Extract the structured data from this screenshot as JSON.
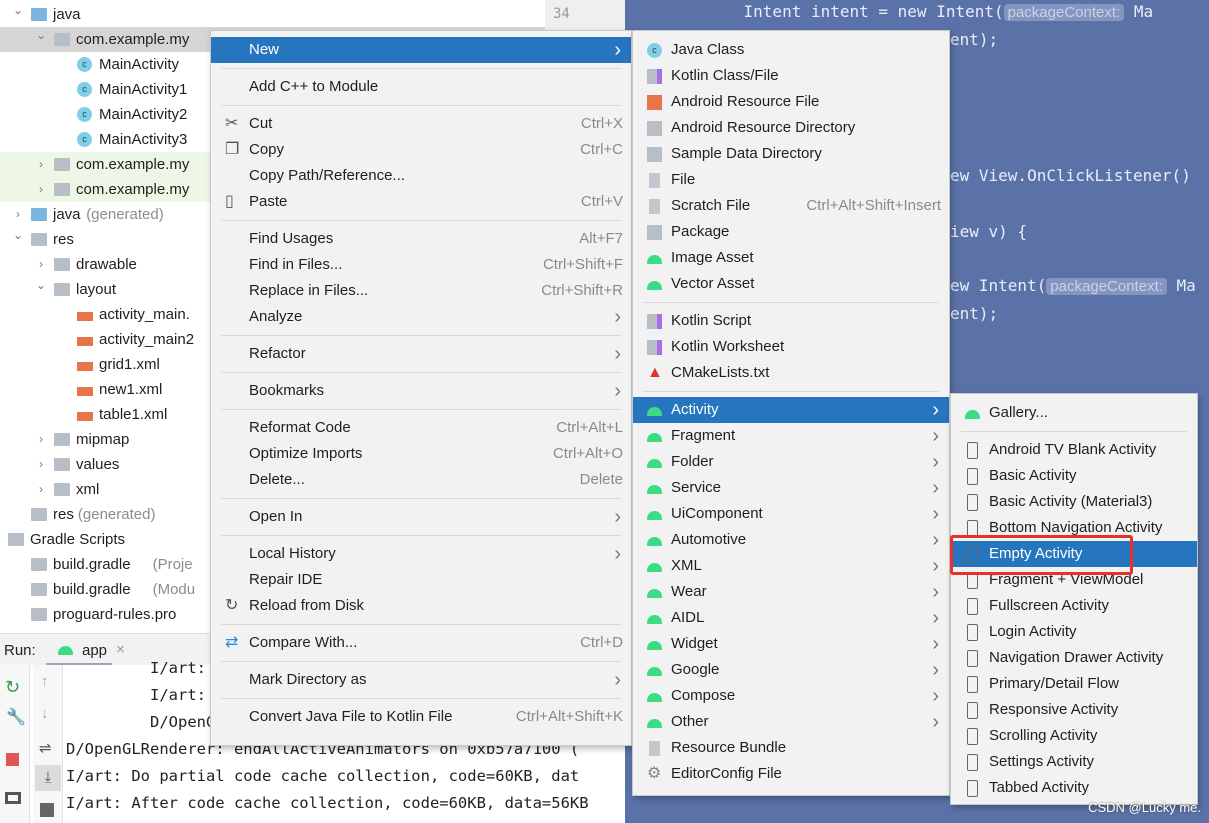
{
  "tree": [
    {
      "label": "java",
      "indent": 0,
      "chev": "v",
      "icon": "folder-blue"
    },
    {
      "label": "com.example.my",
      "indent": 1,
      "chev": "v",
      "icon": "folder",
      "state": "sel"
    },
    {
      "label": "MainActivity",
      "indent": 2,
      "icon": "class"
    },
    {
      "label": "MainActivity1",
      "indent": 2,
      "icon": "class"
    },
    {
      "label": "MainActivity2",
      "indent": 2,
      "icon": "class"
    },
    {
      "label": "MainActivity3",
      "indent": 2,
      "icon": "class"
    },
    {
      "label": "com.example.my",
      "indent": 1,
      "chev": ">",
      "icon": "folder",
      "state": "green"
    },
    {
      "label": "com.example.my",
      "indent": 1,
      "chev": ">",
      "icon": "folder",
      "state": "green"
    },
    {
      "label": "java",
      "suffix": " (generated)",
      "indent": 0,
      "chev": ">",
      "icon": "folder-blue"
    },
    {
      "label": "res",
      "indent": 0,
      "chev": "v",
      "icon": "folder"
    },
    {
      "label": "drawable",
      "indent": 1,
      "chev": ">",
      "icon": "folder"
    },
    {
      "label": "layout",
      "indent": 1,
      "chev": "v",
      "icon": "folder"
    },
    {
      "label": "activity_main.",
      "indent": 2,
      "icon": "xml"
    },
    {
      "label": "activity_main2",
      "indent": 2,
      "icon": "xml"
    },
    {
      "label": "grid1.xml",
      "indent": 2,
      "icon": "xml"
    },
    {
      "label": "new1.xml",
      "indent": 2,
      "icon": "xml"
    },
    {
      "label": "table1.xml",
      "indent": 2,
      "icon": "xml"
    },
    {
      "label": "mipmap",
      "indent": 1,
      "chev": ">",
      "icon": "folder"
    },
    {
      "label": "values",
      "indent": 1,
      "chev": ">",
      "icon": "folder"
    },
    {
      "label": "xml",
      "indent": 1,
      "chev": ">",
      "icon": "folder"
    },
    {
      "label": "res",
      "suffix": " (generated)",
      "indent": 0,
      "icon": "folder"
    },
    {
      "label": "Gradle Scripts",
      "indent": -1,
      "chev": "v",
      "icon": "gradle"
    },
    {
      "label": "build.gradle",
      "suffix": " (Proje",
      "indent": 0,
      "icon": "gradle"
    },
    {
      "label": "build.gradle",
      "suffix": " (Modu",
      "indent": 0,
      "icon": "gradle"
    },
    {
      "label": "proguard-rules.pro",
      "indent": 0,
      "icon": "doc"
    }
  ],
  "gutter": {
    "line": "34"
  },
  "code": [
    {
      "text": "    Intent intent = new Intent(",
      "hint": "packageContext:",
      "after": " Ma"
    },
    {
      "text": "ent);"
    },
    {
      "text": "ew View.OnClickListener()"
    },
    {
      "text": "iew v) {"
    },
    {
      "text": "ew Intent(",
      "hint": "packageContext:",
      "after": " Ma"
    },
    {
      "text": "ent);"
    }
  ],
  "run": {
    "label": "Run:",
    "tab": "app",
    "close": "×"
  },
  "console": [
    "I/art: After",
    "I/art: Increa",
    "D/OpenGLRende",
    "D/OpenGLRenderer: endAllActiveAnimators on 0xb57a7100 (",
    "I/art: Do partial code cache collection, code=60KB, dat",
    "I/art: After code cache collection, code=60KB, data=56KB"
  ],
  "menu1": [
    {
      "label": "New",
      "arrow": true,
      "hl": true
    },
    {
      "sep": true
    },
    {
      "label": "Add C++ to Module"
    },
    {
      "sep": true
    },
    {
      "label": "Cut",
      "shortcut": "Ctrl+X",
      "icon": "scissors"
    },
    {
      "label": "Copy",
      "shortcut": "Ctrl+C",
      "icon": "copy"
    },
    {
      "label": "Copy Path/Reference..."
    },
    {
      "label": "Paste",
      "shortcut": "Ctrl+V",
      "icon": "clipboard"
    },
    {
      "sep": true
    },
    {
      "label": "Find Usages",
      "shortcut": "Alt+F7"
    },
    {
      "label": "Find in Files...",
      "shortcut": "Ctrl+Shift+F"
    },
    {
      "label": "Replace in Files...",
      "shortcut": "Ctrl+Shift+R"
    },
    {
      "label": "Analyze",
      "arrow": true
    },
    {
      "sep": true
    },
    {
      "label": "Refactor",
      "arrow": true
    },
    {
      "sep": true
    },
    {
      "label": "Bookmarks",
      "arrow": true
    },
    {
      "sep": true
    },
    {
      "label": "Reformat Code",
      "shortcut": "Ctrl+Alt+L"
    },
    {
      "label": "Optimize Imports",
      "shortcut": "Ctrl+Alt+O"
    },
    {
      "label": "Delete...",
      "shortcut": "Delete"
    },
    {
      "sep": true
    },
    {
      "label": "Open In",
      "arrow": true
    },
    {
      "sep": true
    },
    {
      "label": "Local History",
      "arrow": true
    },
    {
      "label": "Repair IDE"
    },
    {
      "label": "Reload from Disk",
      "icon": "reload"
    },
    {
      "sep": true
    },
    {
      "label": "Compare With...",
      "shortcut": "Ctrl+D",
      "icon": "compare"
    },
    {
      "sep": true
    },
    {
      "label": "Mark Directory as",
      "arrow": true
    },
    {
      "sep": true
    },
    {
      "label": "Convert Java File to Kotlin File",
      "shortcut": "Ctrl+Alt+Shift+K"
    }
  ],
  "menu2": [
    {
      "label": "Java Class",
      "icon": "class"
    },
    {
      "label": "Kotlin Class/File",
      "icon": "kotlin"
    },
    {
      "label": "Android Resource File",
      "icon": "xml"
    },
    {
      "label": "Android Resource Directory",
      "icon": "folder"
    },
    {
      "label": "Sample Data Directory",
      "icon": "folder"
    },
    {
      "label": "File",
      "icon": "doc"
    },
    {
      "label": "Scratch File",
      "shortcut": "Ctrl+Alt+Shift+Insert",
      "icon": "doc"
    },
    {
      "label": "Package",
      "icon": "folder"
    },
    {
      "label": "Image Asset",
      "icon": "android"
    },
    {
      "label": "Vector Asset",
      "icon": "android"
    },
    {
      "sep": true
    },
    {
      "label": "Kotlin Script",
      "icon": "kotlin"
    },
    {
      "label": "Kotlin Worksheet",
      "icon": "kotlin"
    },
    {
      "label": "CMakeLists.txt",
      "icon": "cmake"
    },
    {
      "sep": true
    },
    {
      "label": "Activity",
      "arrow": true,
      "hl": true,
      "icon": "android"
    },
    {
      "label": "Fragment",
      "arrow": true,
      "icon": "android"
    },
    {
      "label": "Folder",
      "arrow": true,
      "icon": "android"
    },
    {
      "label": "Service",
      "arrow": true,
      "icon": "android"
    },
    {
      "label": "UiComponent",
      "arrow": true,
      "icon": "android"
    },
    {
      "label": "Automotive",
      "arrow": true,
      "icon": "android"
    },
    {
      "label": "XML",
      "arrow": true,
      "icon": "android"
    },
    {
      "label": "Wear",
      "arrow": true,
      "icon": "android"
    },
    {
      "label": "AIDL",
      "arrow": true,
      "icon": "android"
    },
    {
      "label": "Widget",
      "arrow": true,
      "icon": "android"
    },
    {
      "label": "Google",
      "arrow": true,
      "icon": "android"
    },
    {
      "label": "Compose",
      "arrow": true,
      "icon": "android"
    },
    {
      "label": "Other",
      "arrow": true,
      "icon": "android"
    },
    {
      "label": "Resource Bundle",
      "icon": "bundle"
    },
    {
      "label": "EditorConfig File",
      "icon": "gear"
    }
  ],
  "menu3": [
    {
      "label": "Gallery...",
      "icon": "android"
    },
    {
      "sep": true
    },
    {
      "label": "Android TV Blank Activity",
      "icon": "phone"
    },
    {
      "label": "Basic Activity",
      "icon": "phone"
    },
    {
      "label": "Basic Activity (Material3)",
      "icon": "phone"
    },
    {
      "label": "Bottom Navigation Activity",
      "icon": "phone"
    },
    {
      "label": "Empty Activity",
      "icon": "phone",
      "hl": true
    },
    {
      "label": "Fragment + ViewModel",
      "icon": "phone"
    },
    {
      "label": "Fullscreen Activity",
      "icon": "phone"
    },
    {
      "label": "Login Activity",
      "icon": "phone"
    },
    {
      "label": "Navigation Drawer Activity",
      "icon": "phone"
    },
    {
      "label": "Primary/Detail Flow",
      "icon": "phone"
    },
    {
      "label": "Responsive Activity",
      "icon": "phone"
    },
    {
      "label": "Scrolling Activity",
      "icon": "phone"
    },
    {
      "label": "Settings Activity",
      "icon": "phone"
    },
    {
      "label": "Tabbed Activity",
      "icon": "phone"
    }
  ],
  "colors": {
    "highlight": "#2675bf",
    "editor_bg": "#5a72a8",
    "annotation": "#e8312a",
    "android": "#3ddc84"
  },
  "watermark": "CSDN @Lucky me."
}
